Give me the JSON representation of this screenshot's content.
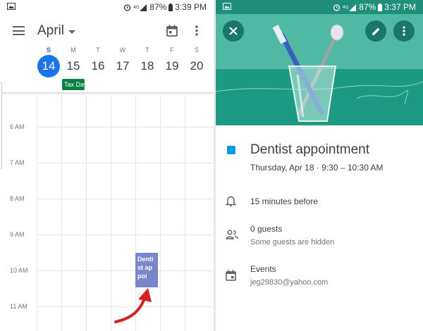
{
  "left_status": {
    "signal": "4G LTE",
    "battery": "87%",
    "time": "3:39 PM"
  },
  "right_status": {
    "signal": "4G LTE",
    "battery": "87%",
    "time": "3:37 PM"
  },
  "calendar": {
    "month": "April",
    "weekdays": [
      "S",
      "M",
      "T",
      "W",
      "T",
      "F",
      "S"
    ],
    "days": [
      "14",
      "15",
      "16",
      "17",
      "18",
      "19",
      "20"
    ],
    "selected_day_index": 0,
    "all_day_event": "Tax Day",
    "hours": [
      "6 AM",
      "7 AM",
      "8 AM",
      "9 AM",
      "10 AM",
      "11 AM"
    ],
    "timed_event_label": "Dentist appoi"
  },
  "event": {
    "title": "Dentist appointment",
    "when": "Thursday, Apr 18  ·  9:30 – 10:30 AM",
    "reminder": "15 minutes before",
    "guests": "0 guests",
    "guests_note": "Some guests are hidden",
    "calendar_name": "Events",
    "calendar_account": "jeg29830@yahoo.com"
  },
  "colors": {
    "accent": "#1a73e8",
    "event": "#7986cb",
    "tax_day": "#0b8043",
    "banner": "#49b49c",
    "swatch": "#039be5"
  }
}
